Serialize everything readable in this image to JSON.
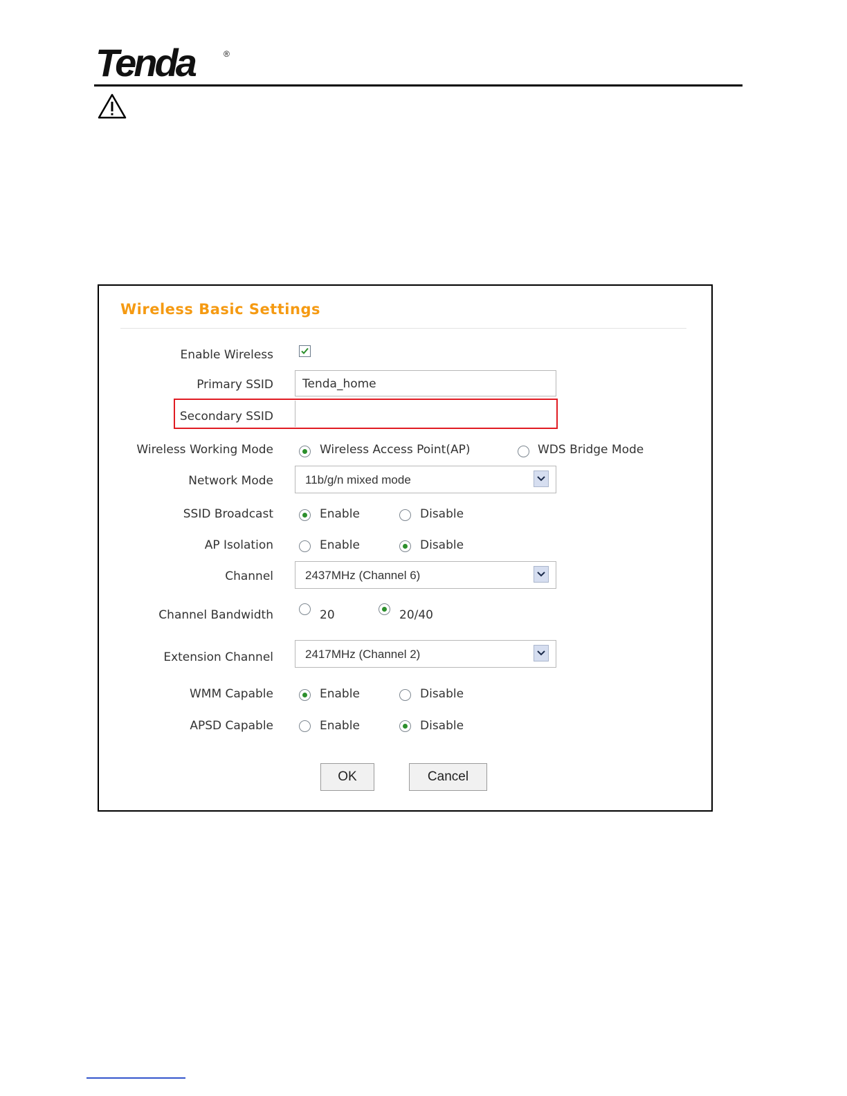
{
  "header": {
    "logo_text": "Tenda",
    "logo_mark": "®"
  },
  "panel": {
    "title": "Wireless Basic Settings",
    "enable_wireless": {
      "label": "Enable Wireless",
      "checked": true
    },
    "primary_ssid": {
      "label": "Primary SSID",
      "value": "Tenda_home"
    },
    "secondary_ssid": {
      "label": "Secondary SSID",
      "value": ""
    },
    "working_mode": {
      "label": "Wireless Working Mode",
      "options": [
        "Wireless Access Point(AP)",
        "WDS Bridge Mode"
      ],
      "selected": "Wireless Access Point(AP)"
    },
    "network_mode": {
      "label": "Network Mode",
      "value": "11b/g/n mixed mode"
    },
    "ssid_broadcast": {
      "label": "SSID Broadcast",
      "enable": "Enable",
      "disable": "Disable",
      "selected": "Enable"
    },
    "ap_isolation": {
      "label": "AP Isolation",
      "enable": "Enable",
      "disable": "Disable",
      "selected": "Disable"
    },
    "channel": {
      "label": "Channel",
      "value": "2437MHz (Channel 6)"
    },
    "bandwidth": {
      "label": "Channel Bandwidth",
      "opt1": "20",
      "opt2": "20/40",
      "selected": "20/40"
    },
    "extension_channel": {
      "label": "Extension Channel",
      "value": "2417MHz (Channel 2)"
    },
    "wmm": {
      "label": "WMM Capable",
      "enable": "Enable",
      "disable": "Disable",
      "selected": "Enable"
    },
    "apsd": {
      "label": "APSD Capable",
      "enable": "Enable",
      "disable": "Disable",
      "selected": "Disable"
    },
    "ok_label": "OK",
    "cancel_label": "Cancel"
  },
  "colors": {
    "title": "#f59a12",
    "highlight": "#e01b22",
    "radio_dot": "#2c8f2c"
  },
  "icons": {
    "warning": "warning-triangle-icon",
    "dropdown": "chevron-down-icon",
    "check": "checkmark-icon"
  }
}
